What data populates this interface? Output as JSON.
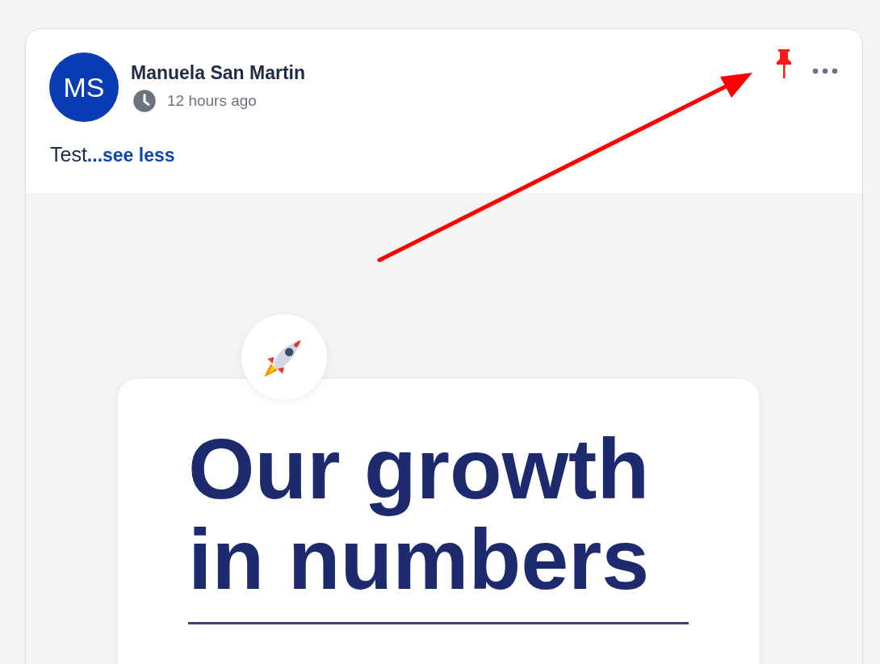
{
  "post": {
    "author": {
      "initials": "MS",
      "name": "Manuela San Martin"
    },
    "time": "12 hours ago",
    "pinned": true,
    "text": "Test",
    "toggle_link": "...see less",
    "image": {
      "heading_lines": [
        "Our growth",
        "in numbers"
      ]
    }
  },
  "annotation": {
    "kind": "arrow"
  }
}
